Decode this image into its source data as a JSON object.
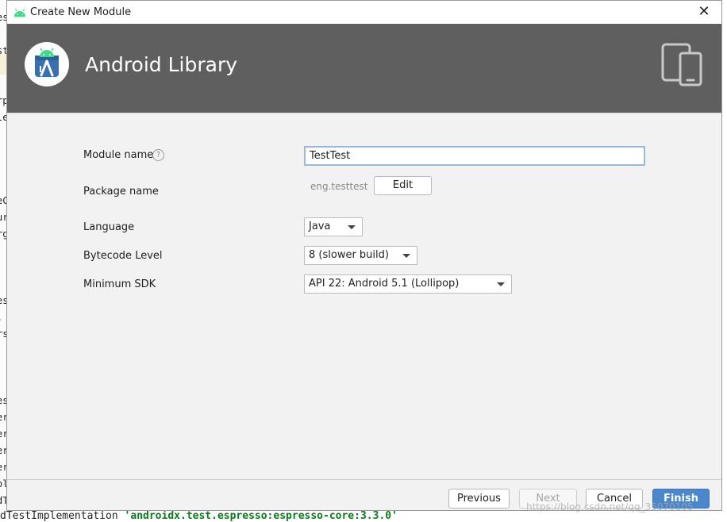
{
  "dialog": {
    "title": "Create New Module",
    "close_glyph": "✕"
  },
  "header": {
    "heading": "Android Library",
    "logo_icon": "android-studio-icon",
    "device_icon": "phone-tablet-icon"
  },
  "form": {
    "module_name": {
      "label": "Module name",
      "help_glyph": "?",
      "value": "TestTest"
    },
    "package_name": {
      "label": "Package name",
      "value": "eng.testtest",
      "edit_label": "Edit"
    },
    "language": {
      "label": "Language",
      "selected": "Java"
    },
    "bytecode_level": {
      "label": "Bytecode Level",
      "selected": "8 (slower build)"
    },
    "minimum_sdk": {
      "label": "Minimum SDK",
      "selected": "API 22: Android 5.1 (Lollipop)"
    }
  },
  "footer": {
    "previous_label": "Previous",
    "next_label": "Next",
    "cancel_label": "Cancel",
    "finish_label": "Finish"
  },
  "background": {
    "code_prefix": "dTestImplementation ",
    "code_string": "'androidx.test.espresso:espresso-core:3.3.0'",
    "left_fragments": [
      "es",
      "st",
      "rp",
      "le",
      "eC",
      "ur",
      "rg",
      "es",
      ".",
      "rs",
      "es",
      "er",
      "er",
      "er",
      "er",
      "ol",
      "dT"
    ]
  },
  "watermark": "https://blog.csdn.net/qq_35070105",
  "colors": {
    "header_bg": "#5f5f5f",
    "primary_button": "#4b87cc",
    "input_focus_border": "#97b9e0",
    "android_green": "#3ddc84"
  }
}
